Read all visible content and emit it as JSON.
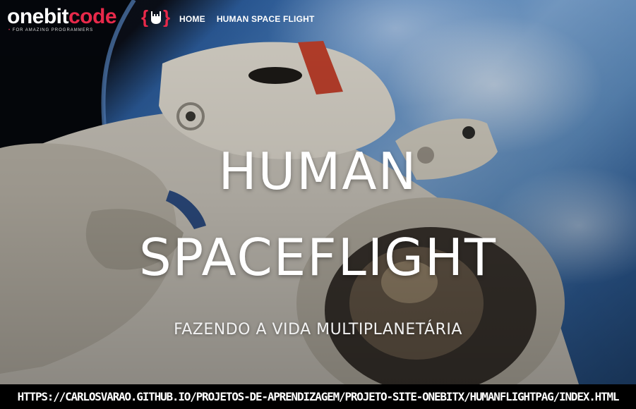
{
  "navbar": {
    "logo": {
      "word_white": "onebit",
      "word_accent": "code",
      "tagline_dot": "•",
      "tagline": "FOR AMAZING PROGRAMMERS"
    },
    "links": [
      {
        "label": "HOME"
      },
      {
        "label": "HUMAN SPACE FLIGHT"
      }
    ]
  },
  "hero": {
    "title_line1": "HUMAN",
    "title_line2": "SPACEFLIGHT",
    "subtitle": "FAZENDO A VIDA MULTIPLANETÁRIA"
  },
  "footer_banner": {
    "url": "HTTPS://CARLOSVARAO.GITHUB.IO/PROJETOS-DE-APRENDIZAGEM/PROJETO-SITE-ONEBITX/HUMANFLIGHTPAG/INDEX.HTML"
  },
  "colors": {
    "accent": "#e8294a",
    "text": "#ffffff",
    "banner_bg": "#000000"
  }
}
